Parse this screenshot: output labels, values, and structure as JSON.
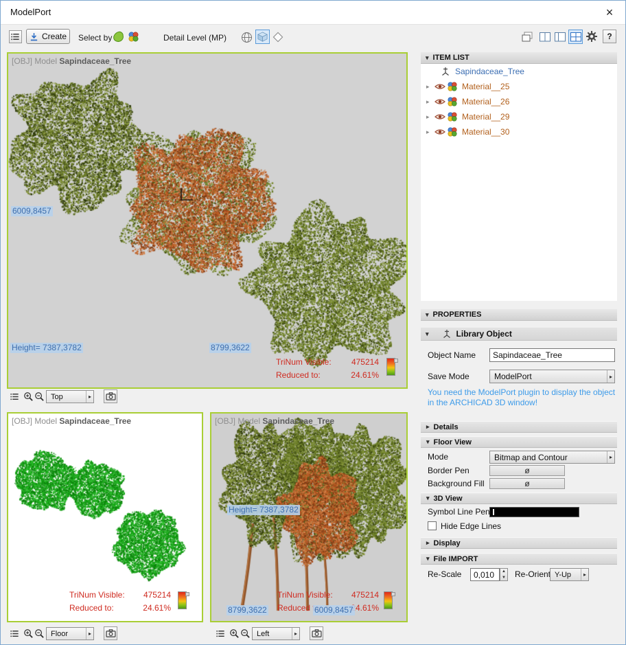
{
  "window": {
    "title": "ModelPort",
    "close_label": "×"
  },
  "icons": {
    "triangle_down": "▾",
    "triangle_right": "▸",
    "arrow_up": "▲",
    "arrow_down": "▼"
  },
  "toolbar": {
    "create_label": "Create",
    "select_by_label": "Select by",
    "detail_level_label": "Detail Level (MP)",
    "help_label": "?"
  },
  "viewport": {
    "header_prefix": "[OBJ] Model",
    "model_name": "Sapindaceae_Tree",
    "trinum_label": "TriNum Visible:",
    "trinum_value": "475214",
    "reduced_label": "Reduced to:",
    "reduced_value": "24.61%",
    "height_label": "Height= 7387,3782",
    "coord_1": "6009,8457",
    "coord_2": "8799,3622",
    "views": {
      "top": "Top",
      "floor": "Floor",
      "left": "Left"
    }
  },
  "item_list": {
    "header": "ITEM LIST",
    "model_item": "Sapindaceae_Tree",
    "materials": [
      "Material__25",
      "Material__26",
      "Material__29",
      "Material__30"
    ]
  },
  "properties": {
    "header": "PROPERTIES",
    "library_object_label": "Library Object",
    "object_name_label": "Object Name",
    "object_name_value": "Sapindaceae_Tree",
    "save_mode_label": "Save Mode",
    "save_mode_value": "ModelPort",
    "hint_line1": "You need the ModelPort plugin to display the object",
    "hint_line2": "in the ARCHICAD 3D window!",
    "details_label": "Details",
    "floor_view_label": "Floor View",
    "mode_label": "Mode",
    "mode_value": "Bitmap and Contour",
    "border_pen_label": "Border Pen",
    "background_fill_label": "Background Fill",
    "empty_pen_symbol": "ø",
    "view_3d_label": "3D View",
    "symbol_line_pen_label": "Symbol Line Pen",
    "hide_edge_lines_label": "Hide Edge Lines",
    "display_label": "Display",
    "file_import_label": "File IMPORT",
    "re_scale_label": "Re-Scale",
    "re_scale_value": "0,010",
    "re_orient_label": "Re-Orient",
    "re_orient_value": "Y-Up"
  }
}
